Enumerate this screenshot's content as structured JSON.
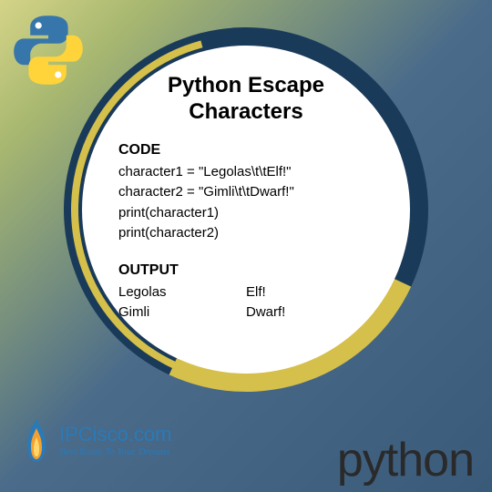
{
  "title": "Python Escape Characters",
  "code": {
    "label": "CODE",
    "lines": [
      "character1 = \"Legolas\\t\\tElf!\"",
      "character2 = \"Gimli\\t\\tDwarf!\"",
      "print(character1)",
      "print(character2)"
    ]
  },
  "output": {
    "label": "OUTPUT",
    "rows": [
      {
        "col1": "Legolas",
        "col2": "Elf!"
      },
      {
        "col1": "Gimli",
        "col2": "Dwarf!"
      }
    ]
  },
  "branding": {
    "site": "IPCisco.com",
    "tagline": "Best Route To Your Dreams",
    "footer": "python"
  }
}
